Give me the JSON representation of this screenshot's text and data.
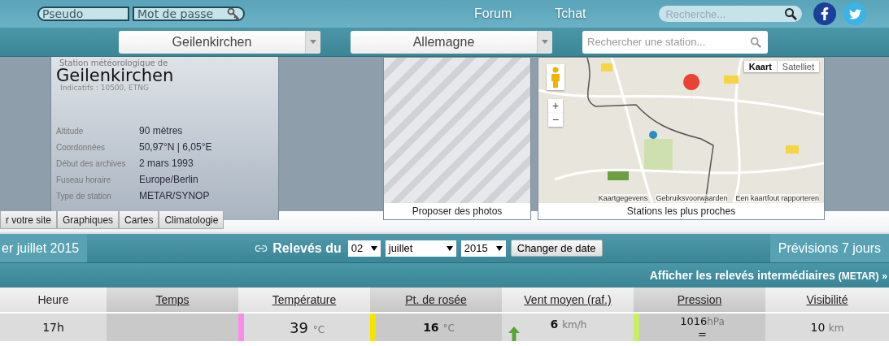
{
  "header": {
    "username_placeholder": "Pseudo",
    "password_placeholder": "Mot de passe",
    "nav": [
      "Forum",
      "Tchat"
    ],
    "search_placeholder": "Recherche..."
  },
  "selectors": {
    "city": "Geilenkirchen",
    "country": "Allemagne",
    "station_search_placeholder": "Rechercher une station..."
  },
  "station": {
    "subtitle": "Station météorologique de",
    "name": "Geilenkirchen",
    "codes": "Indicatifs : 10500, ETNG",
    "details": [
      {
        "label": "Altitude",
        "value": "90 mètres"
      },
      {
        "label": "Coordonnées",
        "value": "50,97°N | 6,05°E"
      },
      {
        "label": "Début des archives",
        "value": "2 mars 1993"
      },
      {
        "label": "Fuseau horaire",
        "value": "Europe/Berlin"
      },
      {
        "label": "Type de station",
        "value": "METAR/SYNOP"
      }
    ]
  },
  "tabs": [
    "r votre site",
    "Graphiques",
    "Cartes",
    "Climatologie"
  ],
  "photos": {
    "caption": "Proposer des photos"
  },
  "map": {
    "map_types": [
      {
        "label": "Kaart",
        "selected": true
      },
      {
        "label": "Satelliet",
        "selected": false
      }
    ],
    "zoom_in": "+",
    "zoom_out": "−",
    "footer": [
      "Kaartgegevens",
      "Gebruiksvoorwaarden",
      "Een kaartfout rapporteren"
    ],
    "caption": "Stations les plus proches"
  },
  "date_bar": {
    "previous": "er juillet 2015",
    "title": "Relevés du",
    "day": "02",
    "month": "juillet",
    "year": "2015",
    "submit": "Changer de date",
    "next": "Prévisions 7 jours"
  },
  "metar_link": {
    "text": "Afficher les relevés intermédiaires",
    "note": "(METAR)",
    "arrow": "»"
  },
  "table": {
    "columns": [
      {
        "label": "Heure",
        "sortable": false
      },
      {
        "label": "Temps",
        "sortable": true
      },
      {
        "label": "Température",
        "sortable": true
      },
      {
        "label": "Pt. de rosée",
        "sortable": true
      },
      {
        "label": "Vent moyen (raf.)",
        "sortable": true
      },
      {
        "label": "Pression",
        "sortable": true
      },
      {
        "label": "Visibilité",
        "sortable": true
      }
    ],
    "rows": [
      {
        "cells": [
          {
            "kind": "time",
            "value": "17h"
          },
          {
            "kind": "weather"
          },
          {
            "kind": "temperature",
            "value": "39",
            "unit": "°C",
            "color": "#f78de8"
          },
          {
            "kind": "temperature",
            "value": "16",
            "unit": "°C",
            "color": "#f5e400"
          },
          {
            "kind": "wind",
            "value": "6",
            "unit": "km/h"
          },
          {
            "kind": "pressure",
            "value": "1016",
            "unit": "hPa",
            "trend": "=",
            "color": "#c6f060"
          },
          {
            "kind": "visibility",
            "value": "10",
            "unit": "km"
          }
        ]
      }
    ]
  }
}
